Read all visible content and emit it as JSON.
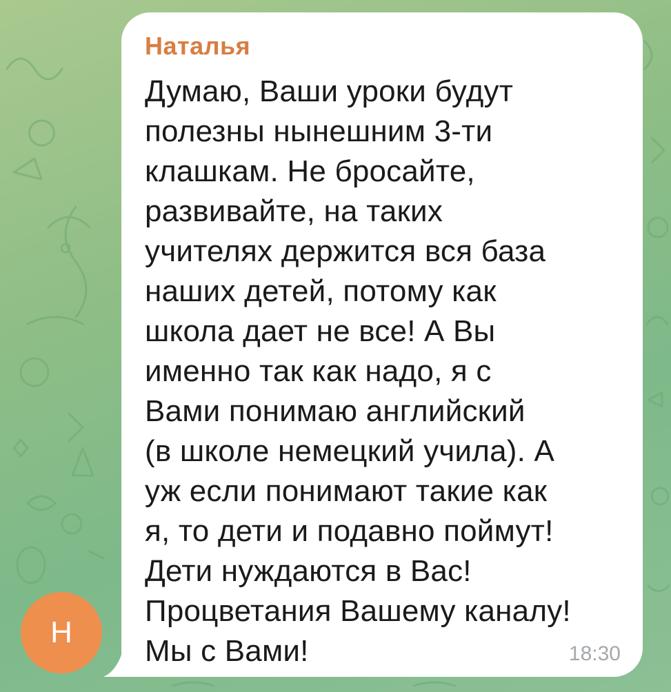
{
  "chat": {
    "avatar_letter": "Н",
    "avatar_color": "#ee8f4e",
    "sender_color": "#d87e42",
    "wallpaper_theme": "doodle-pattern-green",
    "message": {
      "sender": "Наталья",
      "text": "Думаю, Ваши уроки будут\nполезны нынешним 3-ти\nклашкам. Не бросайте,\nразвивайте, на таких\nучителях держится вся база\nнаших детей, потому как\nшкола дает не все! А Вы\nименно так как надо, я с\nВами понимаю английский\n(в школе немецкий учила). А\nуж если понимают такие как\nя, то дети и подавно поймут!\nДети нуждаются в Вас!\nПроцветания Вашему каналу!\nМы с Вами!",
      "time": "18:30"
    }
  }
}
